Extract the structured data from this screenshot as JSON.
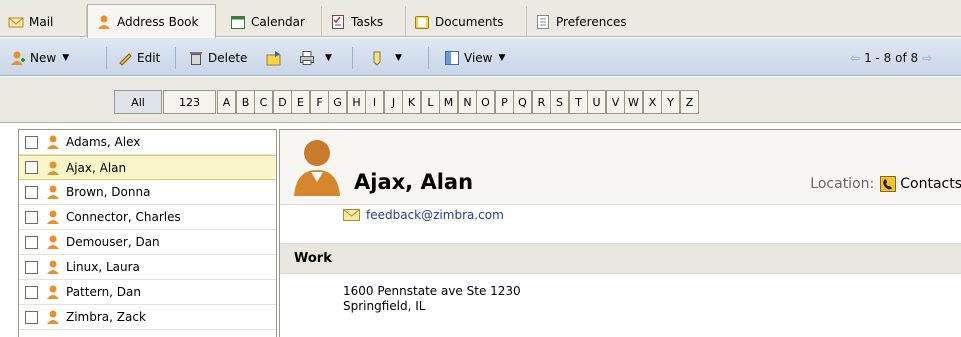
{
  "tabs": [
    {
      "label": "Mail",
      "icon": "envelope-icon"
    },
    {
      "label": "Address Book",
      "icon": "person-icon"
    },
    {
      "label": "Calendar",
      "icon": "calendar-icon"
    },
    {
      "label": "Tasks",
      "icon": "checklist-icon"
    },
    {
      "label": "Documents",
      "icon": "folder-icon"
    },
    {
      "label": "Preferences",
      "icon": "preferences-icon"
    }
  ],
  "toolbar": {
    "new_label": "New",
    "edit_label": "Edit",
    "delete_label": "Delete",
    "view_label": "View",
    "pagination": "1 - 8 of 8"
  },
  "alphabet": [
    "All",
    "123",
    "A",
    "B",
    "C",
    "D",
    "E",
    "F",
    "G",
    "H",
    "I",
    "J",
    "K",
    "L",
    "M",
    "N",
    "O",
    "P",
    "Q",
    "R",
    "S",
    "T",
    "U",
    "V",
    "W",
    "X",
    "Y",
    "Z"
  ],
  "contacts": [
    "Adams, Alex",
    "Ajax, Alan",
    "Brown, Donna",
    "Connector, Charles",
    "Demouser, Dan",
    "Linux, Laura",
    "Pattern, Dan",
    "Zimbra, Zack"
  ],
  "selected_contact": "Ajax, Alan",
  "detail": {
    "name": "Ajax, Alan",
    "location_label": "Location:",
    "location_value": "Contacts",
    "email": "feedback@zimbra.com",
    "section_title": "Work",
    "address_line1": "1600 Pennstate ave Ste 1230",
    "address_line2": "Springfield, IL"
  },
  "colors": {
    "accent": "#e8902a",
    "selection": "#fbf6c8",
    "link": "#1d3f9a"
  }
}
